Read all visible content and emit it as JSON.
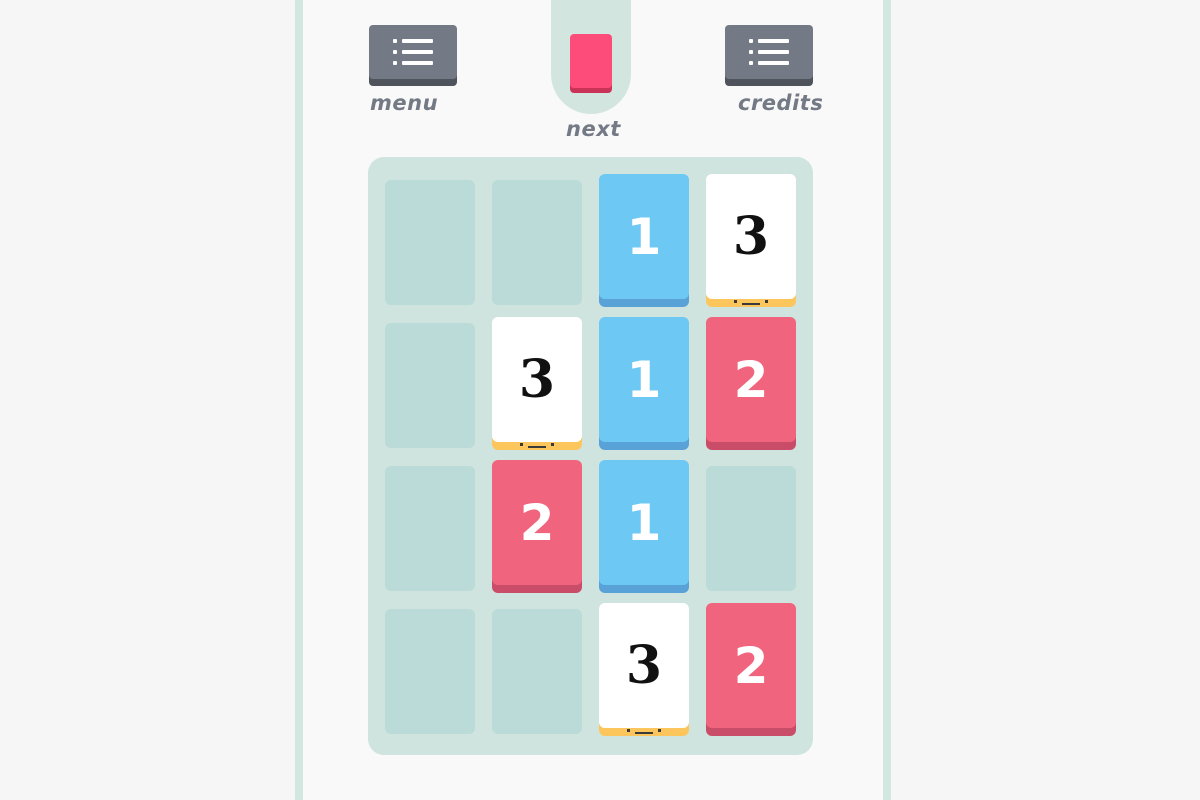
{
  "controls": {
    "menu_label": "menu",
    "next_label": "next",
    "credits_label": "credits",
    "menu_icon": "list-icon",
    "credits_icon": "list-icon",
    "next_tile_color": "#fe4c7a"
  },
  "board": {
    "rows": 4,
    "cols": 4,
    "tiles": [
      {
        "row": 0,
        "col": 2,
        "value": "1"
      },
      {
        "row": 0,
        "col": 3,
        "value": "3"
      },
      {
        "row": 1,
        "col": 1,
        "value": "3"
      },
      {
        "row": 1,
        "col": 2,
        "value": "1"
      },
      {
        "row": 1,
        "col": 3,
        "value": "2"
      },
      {
        "row": 2,
        "col": 1,
        "value": "2"
      },
      {
        "row": 2,
        "col": 2,
        "value": "1"
      },
      {
        "row": 3,
        "col": 2,
        "value": "3"
      },
      {
        "row": 3,
        "col": 3,
        "value": "2"
      }
    ]
  },
  "colors": {
    "one": "#6ec8f4",
    "two": "#f0657d",
    "three": "#ffffff",
    "board": "#cfe4de",
    "empty_slot": "#bbdbd8"
  }
}
